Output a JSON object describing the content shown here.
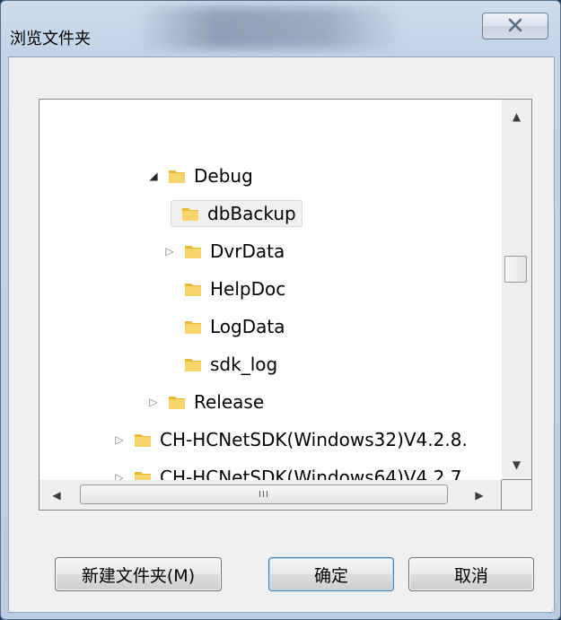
{
  "window": {
    "title": "浏览文件夹",
    "close_glyph": "☒"
  },
  "tree": {
    "items": [
      {
        "label": "Debug",
        "expander": "open"
      },
      {
        "label": "dbBackup",
        "expander": "none",
        "selected": true
      },
      {
        "label": "DvrData",
        "expander": "closed"
      },
      {
        "label": "HelpDoc",
        "expander": "none"
      },
      {
        "label": "LogData",
        "expander": "none"
      },
      {
        "label": "sdk_log",
        "expander": "none"
      },
      {
        "label": "Release",
        "expander": "closed"
      },
      {
        "label": "CH-HCNetSDK(Windows32)V4.2.8.",
        "expander": "closed"
      },
      {
        "label": "CH-HCNetSDK(Windows64)V4.2.7.",
        "expander": "closed"
      }
    ]
  },
  "scrollbars": {
    "up_arrow": "▲",
    "down_arrow": "▼",
    "left_arrow": "◀",
    "right_arrow": "▶",
    "hthumb_grip": "III"
  },
  "buttons": {
    "new_folder": "新建文件夹(M)",
    "ok": "确定",
    "cancel": "取消"
  },
  "colors": {
    "folder_yellow": "#f2c94c",
    "accent": "#3c7fb1"
  }
}
